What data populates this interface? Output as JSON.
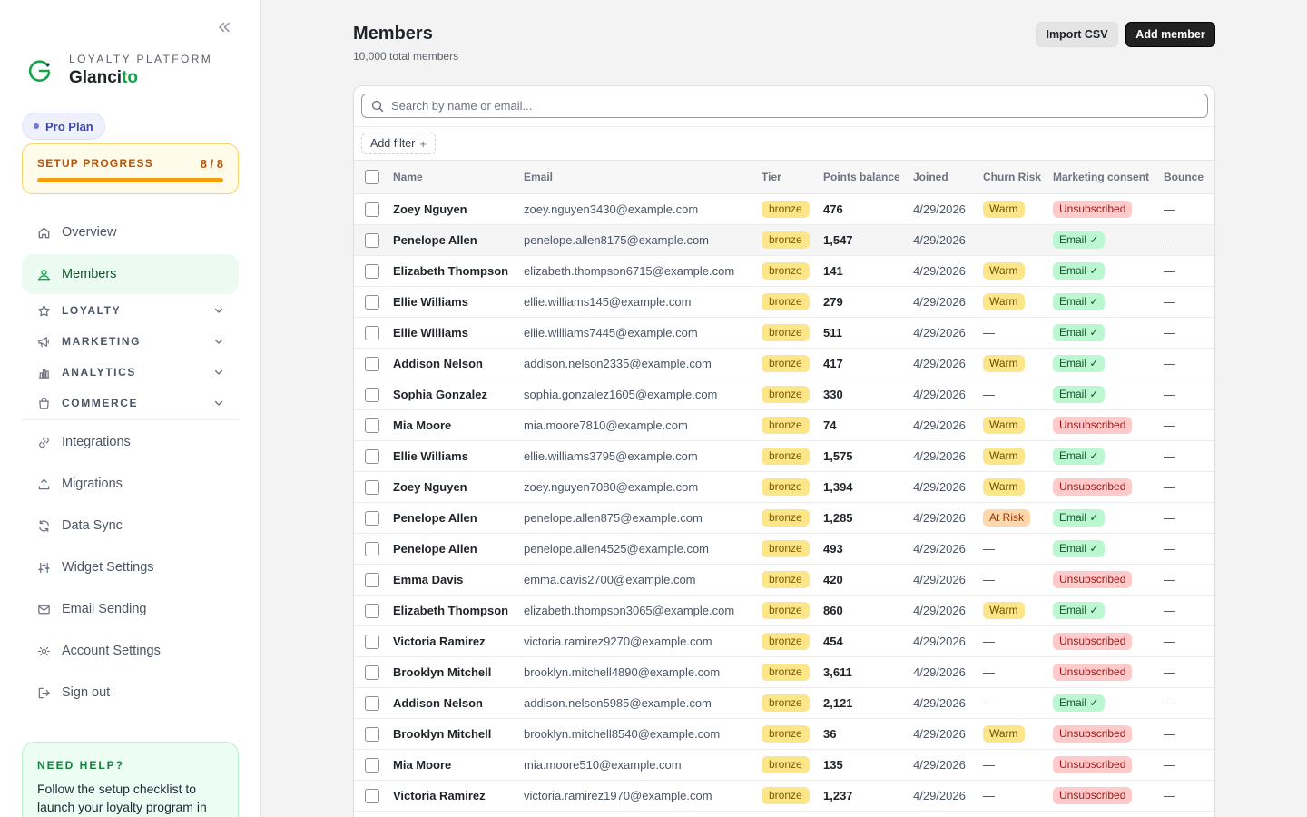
{
  "sidebar": {
    "brand_sub": "LOYALTY PLATFORM",
    "brand_name_main": "Glanci",
    "brand_name_accent": "to",
    "plan": "Pro Plan",
    "setup": {
      "label": "SETUP PROGRESS",
      "count": "8 / 8",
      "progress_fraction": 1.0
    },
    "nav": {
      "overview": "Overview",
      "members": "Members",
      "loyalty": "LOYALTY",
      "marketing": "MARKETING",
      "analytics": "ANALYTICS",
      "commerce": "COMMERCE",
      "integrations": "Integrations",
      "migrations": "Migrations",
      "data_sync": "Data Sync",
      "widget_settings": "Widget Settings",
      "email_sending": "Email Sending",
      "account_settings": "Account Settings",
      "sign_out": "Sign out"
    },
    "help": {
      "title": "NEED HELP?",
      "text": "Follow the setup checklist to launch your loyalty program in"
    }
  },
  "header": {
    "title": "Members",
    "subtitle": "10,000 total members",
    "import_label": "Import CSV",
    "add_label": "Add member"
  },
  "search": {
    "placeholder": "Search by name or email..."
  },
  "filter": {
    "add_label": "Add filter",
    "plus": "+"
  },
  "table": {
    "columns": [
      "Name",
      "Email",
      "Tier",
      "Points balance",
      "Joined",
      "Churn Risk",
      "Marketing consent",
      "Bounce"
    ],
    "rows": [
      {
        "name": "Zoey Nguyen",
        "email": "zoey.nguyen3430@example.com",
        "tier": "bronze",
        "points": "476",
        "joined": "4/29/2026",
        "churn": "Warm",
        "consent": "Unsubscribed",
        "bounce": "—"
      },
      {
        "name": "Penelope Allen",
        "email": "penelope.allen8175@example.com",
        "tier": "bronze",
        "points": "1,547",
        "joined": "4/29/2026",
        "churn": "—",
        "consent": "Email ✓",
        "bounce": "—"
      },
      {
        "name": "Elizabeth Thompson",
        "email": "elizabeth.thompson6715@example.com",
        "tier": "bronze",
        "points": "141",
        "joined": "4/29/2026",
        "churn": "Warm",
        "consent": "Email ✓",
        "bounce": "—"
      },
      {
        "name": "Ellie Williams",
        "email": "ellie.williams145@example.com",
        "tier": "bronze",
        "points": "279",
        "joined": "4/29/2026",
        "churn": "Warm",
        "consent": "Email ✓",
        "bounce": "—"
      },
      {
        "name": "Ellie Williams",
        "email": "ellie.williams7445@example.com",
        "tier": "bronze",
        "points": "511",
        "joined": "4/29/2026",
        "churn": "—",
        "consent": "Email ✓",
        "bounce": "—"
      },
      {
        "name": "Addison Nelson",
        "email": "addison.nelson2335@example.com",
        "tier": "bronze",
        "points": "417",
        "joined": "4/29/2026",
        "churn": "Warm",
        "consent": "Email ✓",
        "bounce": "—"
      },
      {
        "name": "Sophia Gonzalez",
        "email": "sophia.gonzalez1605@example.com",
        "tier": "bronze",
        "points": "330",
        "joined": "4/29/2026",
        "churn": "—",
        "consent": "Email ✓",
        "bounce": "—"
      },
      {
        "name": "Mia Moore",
        "email": "mia.moore7810@example.com",
        "tier": "bronze",
        "points": "74",
        "joined": "4/29/2026",
        "churn": "Warm",
        "consent": "Unsubscribed",
        "bounce": "—"
      },
      {
        "name": "Ellie Williams",
        "email": "ellie.williams3795@example.com",
        "tier": "bronze",
        "points": "1,575",
        "joined": "4/29/2026",
        "churn": "Warm",
        "consent": "Email ✓",
        "bounce": "—"
      },
      {
        "name": "Zoey Nguyen",
        "email": "zoey.nguyen7080@example.com",
        "tier": "bronze",
        "points": "1,394",
        "joined": "4/29/2026",
        "churn": "Warm",
        "consent": "Unsubscribed",
        "bounce": "—"
      },
      {
        "name": "Penelope Allen",
        "email": "penelope.allen875@example.com",
        "tier": "bronze",
        "points": "1,285",
        "joined": "4/29/2026",
        "churn": "At Risk",
        "consent": "Email ✓",
        "bounce": "—"
      },
      {
        "name": "Penelope Allen",
        "email": "penelope.allen4525@example.com",
        "tier": "bronze",
        "points": "493",
        "joined": "4/29/2026",
        "churn": "—",
        "consent": "Email ✓",
        "bounce": "—"
      },
      {
        "name": "Emma Davis",
        "email": "emma.davis2700@example.com",
        "tier": "bronze",
        "points": "420",
        "joined": "4/29/2026",
        "churn": "—",
        "consent": "Unsubscribed",
        "bounce": "—"
      },
      {
        "name": "Elizabeth Thompson",
        "email": "elizabeth.thompson3065@example.com",
        "tier": "bronze",
        "points": "860",
        "joined": "4/29/2026",
        "churn": "Warm",
        "consent": "Email ✓",
        "bounce": "—"
      },
      {
        "name": "Victoria Ramirez",
        "email": "victoria.ramirez9270@example.com",
        "tier": "bronze",
        "points": "454",
        "joined": "4/29/2026",
        "churn": "—",
        "consent": "Unsubscribed",
        "bounce": "—"
      },
      {
        "name": "Brooklyn Mitchell",
        "email": "brooklyn.mitchell4890@example.com",
        "tier": "bronze",
        "points": "3,611",
        "joined": "4/29/2026",
        "churn": "—",
        "consent": "Unsubscribed",
        "bounce": "—"
      },
      {
        "name": "Addison Nelson",
        "email": "addison.nelson5985@example.com",
        "tier": "bronze",
        "points": "2,121",
        "joined": "4/29/2026",
        "churn": "—",
        "consent": "Email ✓",
        "bounce": "—"
      },
      {
        "name": "Brooklyn Mitchell",
        "email": "brooklyn.mitchell8540@example.com",
        "tier": "bronze",
        "points": "36",
        "joined": "4/29/2026",
        "churn": "Warm",
        "consent": "Unsubscribed",
        "bounce": "—"
      },
      {
        "name": "Mia Moore",
        "email": "mia.moore510@example.com",
        "tier": "bronze",
        "points": "135",
        "joined": "4/29/2026",
        "churn": "—",
        "consent": "Unsubscribed",
        "bounce": "—"
      },
      {
        "name": "Victoria Ramirez",
        "email": "victoria.ramirez1970@example.com",
        "tier": "bronze",
        "points": "1,237",
        "joined": "4/29/2026",
        "churn": "—",
        "consent": "Unsubscribed",
        "bounce": "—"
      }
    ]
  },
  "colors": {
    "accent_green": "#16a34a",
    "active_nav_bg": "#ebfbf1",
    "setup_bar": "#f59e0b",
    "tier_bronze": "#fde68a",
    "churn_warm": "#fde68a",
    "churn_at_risk": "#fed7aa",
    "consent_email": "#bbf7d0",
    "consent_unsubscribed": "#fecaca",
    "primary_button": "#222222"
  },
  "icons": {
    "collapse": "double-chevron-left-icon",
    "overview": "home-icon",
    "members": "users-icon",
    "loyalty": "star-icon",
    "marketing": "megaphone-icon",
    "analytics": "bar-chart-icon",
    "commerce": "shopping-bag-icon",
    "integrations": "link-icon",
    "migrations": "upload-icon",
    "data_sync": "refresh-icon",
    "widget_settings": "sliders-icon",
    "email_sending": "mail-icon",
    "account_settings": "gear-icon",
    "sign_out": "sign-out-icon",
    "search": "search-icon"
  }
}
